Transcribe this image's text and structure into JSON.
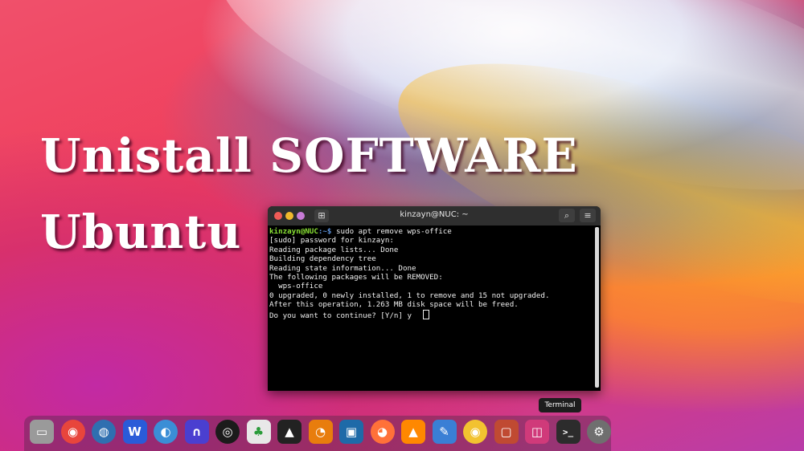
{
  "headline": {
    "line1": "Unistall  SOFTWARE",
    "line2": "Ubuntu"
  },
  "terminal": {
    "window_title": "kinzayn@NUC: ~",
    "prompt_user": "kinzayn@NUC",
    "prompt_path": ":~$",
    "command": " sudo apt remove wps-office",
    "output": [
      "[sudo] password for kinzayn:",
      "Reading package lists... Done",
      "Building dependency tree",
      "Reading state information... Done",
      "The following packages will be REMOVED:",
      "  wps-office",
      "0 upgraded, 0 newly installed, 1 to remove and 15 not upgraded.",
      "After this operation, 1.263 MB disk space will be freed.",
      "Do you want to continue? [Y/n] y"
    ]
  },
  "tooltip": "Terminal",
  "dock": {
    "apps": [
      {
        "icon": "files-icon",
        "color": "#9a9a9a"
      },
      {
        "icon": "chrome-icon",
        "color": "#e8453c"
      },
      {
        "icon": "earth-browser-icon",
        "color": "#2f6fb0"
      },
      {
        "icon": "wps-office-icon",
        "color": "#2a5bd8"
      },
      {
        "icon": "qbittorrent-icon",
        "color": "#3b8ed6"
      },
      {
        "icon": "headphones-icon",
        "color": "#4a3fd0"
      },
      {
        "icon": "obs-studio-icon",
        "color": "#1b1b1b"
      },
      {
        "icon": "solitaire-icon",
        "color": "#e8e8e8"
      },
      {
        "icon": "inkscape-icon",
        "color": "#222222"
      },
      {
        "icon": "blender-icon",
        "color": "#e87d0d"
      },
      {
        "icon": "image-viewer-icon",
        "color": "#1e6aa8"
      },
      {
        "icon": "firefox-icon",
        "color": "#ff7139"
      },
      {
        "icon": "vlc-icon",
        "color": "#ff8800"
      },
      {
        "icon": "text-editor-icon",
        "color": "#3a7fd5"
      },
      {
        "icon": "rhythmbox-icon",
        "color": "#f2c230"
      },
      {
        "icon": "screenshot-icon",
        "color": "#c04a32"
      },
      {
        "icon": "tweaks-icon",
        "color": "#d03a7a"
      },
      {
        "icon": "terminal-icon",
        "color": "#2c2c2c"
      },
      {
        "icon": "settings-icon",
        "color": "#6f6f6f"
      }
    ]
  }
}
